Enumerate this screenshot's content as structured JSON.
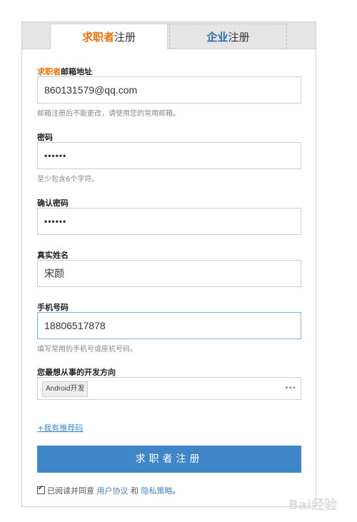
{
  "tabs": {
    "seeker": {
      "highlight": "求职者",
      "suffix": "注册"
    },
    "company": {
      "highlight": "企业",
      "suffix": "注册"
    }
  },
  "form": {
    "email": {
      "label_highlight": "求职者",
      "label": "邮箱地址",
      "value": "860131579@qq.com",
      "hint": "邮箱注册后不能更改，请使用您的常用邮箱。"
    },
    "password": {
      "label": "密码",
      "value": "••••••",
      "hint": "至少包含6个字符。"
    },
    "confirm": {
      "label": "确认密码",
      "value": "••••••"
    },
    "realname": {
      "label": "真实姓名",
      "value": "宋颜"
    },
    "phone": {
      "label": "手机号码",
      "value": "18806517878",
      "hint": "填写常用的手机号或座机号码。"
    },
    "direction": {
      "label": "您最想从事的开发方向",
      "selected": "Android开发",
      "more": "•••"
    },
    "referral_link": "+我有推荐码",
    "submit_label": "求职者注册",
    "agree": {
      "prefix": "已阅读并同意",
      "user_agreement": "用户协议",
      "and": "和",
      "privacy": "隐私策略",
      "end": "。"
    }
  },
  "watermark": "Bai经验",
  "colors": {
    "accent_orange": "#f0700a",
    "accent_blue": "#3f86c8"
  }
}
